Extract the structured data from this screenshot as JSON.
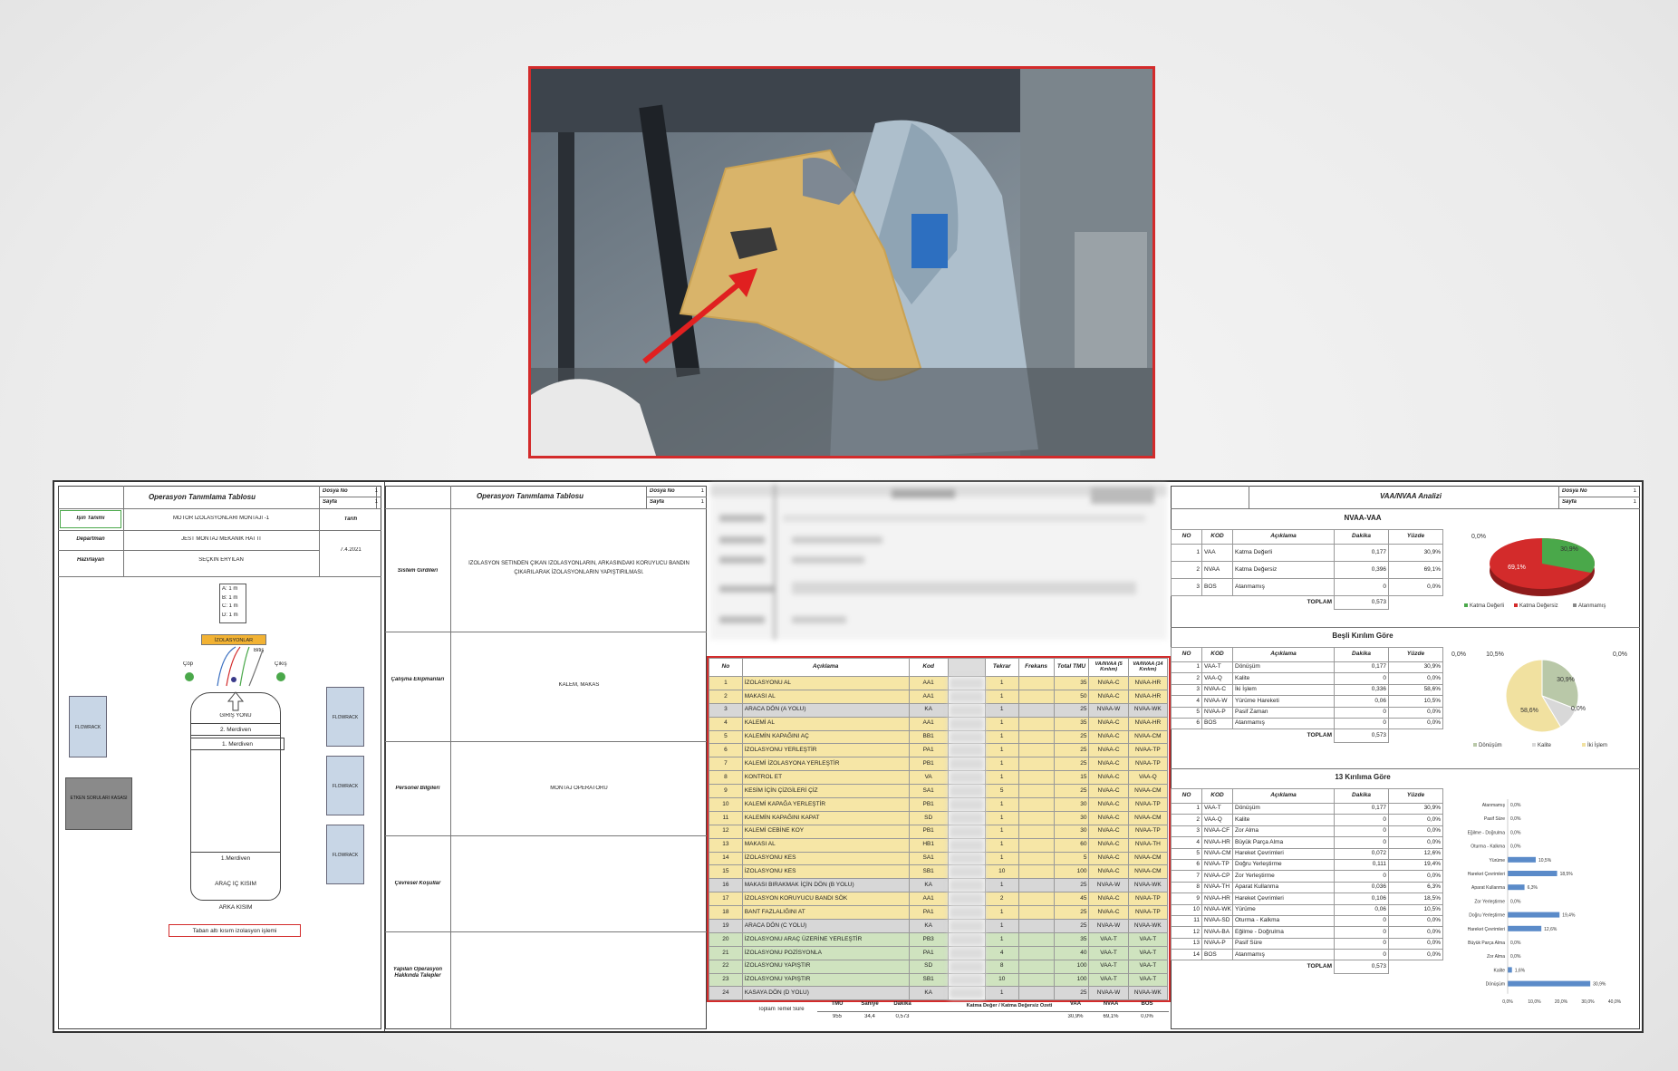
{
  "left_sheet": {
    "title": "Operasyon Tanımlama Tablosu",
    "meta": [
      "Dosya No",
      "Sayfa"
    ],
    "meta_vals": [
      "1",
      "1"
    ],
    "rows": [
      {
        "label": "İşin Tanımı",
        "value": "MOTOR İZOLASYONLARI MONTAJI -1"
      },
      {
        "label": "Departman",
        "value": "JEST MONTAJ MEKANİK HATTI"
      },
      {
        "label": "Hazırlayan",
        "value": "SEÇKİN ERYILAN"
      }
    ],
    "date_label": "Tarih",
    "date": "7.4.2021",
    "legend": [
      "A: 1 m",
      "B: 1 m",
      "C: 1 m",
      "D: 1 m"
    ],
    "box_izolasyonlar": "İZOLASYONLAR",
    "bitis": "Bitiş",
    "cop": "Çöp",
    "cikis": "Çıkış",
    "giris_yonu": "GİRİŞ YÖNÜ",
    "merdiven2": "2. Merdiven",
    "merdiven1": "1. Merdiven",
    "merdiven1b": "1.Merdiven",
    "arac_ic": "ARAÇ İÇ KISIM",
    "arka": "ARKA KISIM",
    "flowrack": "FLOWRACK",
    "etken": "ETKEN SORULARI KASASI",
    "caption": "Taban altı kısım izolasyon işlemi"
  },
  "mid_sheet": {
    "title": "Operasyon Tanımlama Tablosu",
    "meta": [
      "Dosya No",
      "Sayfa"
    ],
    "meta_vals": [
      "1",
      "1"
    ],
    "sections": [
      {
        "label": "Sistem Girdileri",
        "value": "İZOLASYON SETİNDEN ÇIKAN İZOLASYONLARIN, ARKASINDAKİ KORUYUCU BANDIN ÇIKARILARAK İZOLASYONLARIN YAPIŞTIRILMASI."
      },
      {
        "label": "Çalışma Ekipmanları",
        "value": "KALEM, MAKAS"
      },
      {
        "label": "Personel Bilgileri",
        "value": "MONTAJ OPERATÖRÜ"
      },
      {
        "label": "Çevresel Koşullar",
        "value": ""
      },
      {
        "label": "Yapılan Operasyon Hakkında Talepler",
        "value": ""
      }
    ]
  },
  "table": {
    "headers": [
      "No",
      "Açıklama",
      "Kod",
      "",
      "Tekrar",
      "Frekans",
      "Total TMU",
      "VA/NVAA (5 Kırılım)",
      "VA/NVAA (14 Kırılım)"
    ],
    "rows": [
      [
        "1",
        "İZOLASYONU AL",
        "AA1",
        "1",
        "35",
        "NVAA-C",
        "NVAA-HR",
        "y"
      ],
      [
        "2",
        "MAKASI AL",
        "AA1",
        "1",
        "50",
        "NVAA-C",
        "NVAA-HR",
        "y"
      ],
      [
        "3",
        "ARACA DÖN (A YOLU)",
        "KA",
        "1",
        "25",
        "NVAA-W",
        "NVAA-WK",
        "g"
      ],
      [
        "4",
        "KALEMİ AL",
        "AA1",
        "1",
        "35",
        "NVAA-C",
        "NVAA-HR",
        "y"
      ],
      [
        "5",
        "KALEMİN KAPAĞINI AÇ",
        "BB1",
        "1",
        "25",
        "NVAA-C",
        "NVAA-CM",
        "y"
      ],
      [
        "6",
        "İZOLASYONU YERLEŞTİR",
        "PA1",
        "1",
        "25",
        "NVAA-C",
        "NVAA-TP",
        "y"
      ],
      [
        "7",
        "KALEMİ İZOLASYONA YERLEŞTİR",
        "PB1",
        "1",
        "25",
        "NVAA-C",
        "NVAA-TP",
        "y"
      ],
      [
        "8",
        "KONTROL ET",
        "VA",
        "1",
        "15",
        "NVAA-C",
        "VAA-Q",
        "y"
      ],
      [
        "9",
        "KESİM İÇİN ÇİZGİLERİ ÇİZ",
        "SA1",
        "5",
        "25",
        "NVAA-C",
        "NVAA-CM",
        "y"
      ],
      [
        "10",
        "KALEMİ KAPAĞA YERLEŞTİR",
        "PB1",
        "1",
        "30",
        "NVAA-C",
        "NVAA-TP",
        "y"
      ],
      [
        "11",
        "KALEMİN KAPAĞINI KAPAT",
        "SD",
        "1",
        "30",
        "NVAA-C",
        "NVAA-CM",
        "y"
      ],
      [
        "12",
        "KALEMİ CEBİNE KOY",
        "PB1",
        "1",
        "30",
        "NVAA-C",
        "NVAA-TP",
        "y"
      ],
      [
        "13",
        "MAKASI AL",
        "HB1",
        "1",
        "60",
        "NVAA-C",
        "NVAA-TH",
        "y"
      ],
      [
        "14",
        "İZOLASYONU KES",
        "SA1",
        "1",
        "5",
        "NVAA-C",
        "NVAA-CM",
        "y"
      ],
      [
        "15",
        "İZOLASYONU KES",
        "SB1",
        "10",
        "100",
        "NVAA-C",
        "NVAA-CM",
        "y"
      ],
      [
        "16",
        "MAKASI BIRAKMAK İÇİN DÖN (B YOLU)",
        "KA",
        "1",
        "25",
        "NVAA-W",
        "NVAA-WK",
        "g"
      ],
      [
        "17",
        "İZOLASYON KORUYUCU BANDI SÖK",
        "AA1",
        "2",
        "45",
        "NVAA-C",
        "NVAA-TP",
        "y"
      ],
      [
        "18",
        "BANT FAZLALIĞINI AT",
        "PA1",
        "1",
        "25",
        "NVAA-C",
        "NVAA-TP",
        "y"
      ],
      [
        "19",
        "ARACA DÖN (C YOLU)",
        "KA",
        "1",
        "25",
        "NVAA-W",
        "NVAA-WK",
        "g"
      ],
      [
        "20",
        "İZOLASYONU ARAÇ ÜZERİNE YERLEŞTİR",
        "PB3",
        "1",
        "35",
        "VAA-T",
        "VAA-T",
        "gr"
      ],
      [
        "21",
        "İZOLASYONU POZİSYONLA",
        "PA1",
        "4",
        "40",
        "VAA-T",
        "VAA-T",
        "gr"
      ],
      [
        "22",
        "İZOLASYONU YAPIŞTIR",
        "SD",
        "8",
        "100",
        "VAA-T",
        "VAA-T",
        "gr"
      ],
      [
        "23",
        "İZOLASYONU YAPIŞTIR",
        "SB1",
        "10",
        "100",
        "VAA-T",
        "VAA-T",
        "gr"
      ],
      [
        "24",
        "KASAYA DÖN (D YOLU)",
        "KA",
        "1",
        "25",
        "NVAA-W",
        "NVAA-WK",
        "g"
      ]
    ],
    "footer_left": "Toplam Temel Süre",
    "footer_heads": [
      "TMU",
      "Saniye",
      "Dakika"
    ],
    "footer_vals": [
      "955",
      "34,4",
      "0,573"
    ],
    "footer_mid": "Katma Değer / Katma Değersiz Özeti",
    "footer_cats": [
      "VAA",
      "NVAA",
      "BOS"
    ],
    "footer_pcts": [
      "30,9%",
      "69,1%",
      "0,0%"
    ]
  },
  "analysis": {
    "title": "VAA/NVAA Analizi",
    "meta": [
      "Dosya No",
      "Sayfa"
    ],
    "meta_vals": [
      "1",
      "1"
    ],
    "s1_title": "NVAA-VAA",
    "s1_heads": [
      "NO",
      "KOD",
      "Açıklama",
      "Dakika",
      "Yüzde"
    ],
    "s1_rows": [
      [
        "1",
        "VAA",
        "Katma Değerli",
        "0,177",
        "30,9%"
      ],
      [
        "2",
        "NVAA",
        "Katma Değersiz",
        "0,396",
        "69,1%"
      ],
      [
        "3",
        "BOS",
        "Atanmamış",
        "0",
        "0,0%"
      ]
    ],
    "toplam": "TOPLAM",
    "total1": "0,573",
    "pie1": {
      "labels": [
        "0,0%",
        "30,9%",
        "69,1%"
      ],
      "legend": [
        "Katma Değerli",
        "Katma Değersiz",
        "Atanmamış"
      ]
    },
    "s2_title": "Beşli Kırılım Göre",
    "s2_rows": [
      [
        "1",
        "VAA-T",
        "Dönüşüm",
        "0,177",
        "30,9%"
      ],
      [
        "2",
        "VAA-Q",
        "Kalite",
        "0",
        "0,0%"
      ],
      [
        "3",
        "NVAA-C",
        "İki İşlem",
        "0,336",
        "58,6%"
      ],
      [
        "4",
        "NVAA-W",
        "Yürüme Hareketi",
        "0,06",
        "10,5%"
      ],
      [
        "5",
        "NVAA-P",
        "Pasif Zaman",
        "0",
        "0,0%"
      ],
      [
        "6",
        "BOS",
        "Atanmamış",
        "0",
        "0,0%"
      ]
    ],
    "total2": "0,573",
    "pie2": {
      "labels": [
        "0,0%",
        "10,5%",
        "0,0%",
        "30,9%",
        "58,6%",
        "0,0%"
      ],
      "legend": [
        "Dönüşüm",
        "Kalite",
        "İki İşlem"
      ]
    },
    "s3_title": "13 Kırılıma Göre",
    "s3_rows": [
      [
        "1",
        "VAA-T",
        "Dönüşüm",
        "0,177",
        "30,9%"
      ],
      [
        "2",
        "VAA-Q",
        "Kalite",
        "0",
        "0,0%"
      ],
      [
        "3",
        "NVAA-CF",
        "Zor Alma",
        "0",
        "0,0%"
      ],
      [
        "4",
        "NVAA-HR",
        "Büyük Parça Alma",
        "0",
        "0,0%"
      ],
      [
        "5",
        "NVAA-CM",
        "Hareket Çevrimleri",
        "0,072",
        "12,6%"
      ],
      [
        "6",
        "NVAA-TP",
        "Doğru Yerleştirme",
        "0,111",
        "19,4%"
      ],
      [
        "7",
        "NVAA-CP",
        "Zor Yerleştirme",
        "0",
        "0,0%"
      ],
      [
        "8",
        "NVAA-TH",
        "Aparat Kullanma",
        "0,036",
        "6,3%"
      ],
      [
        "9",
        "NVAA-HR",
        "Hareket Çevrimleri",
        "0,106",
        "18,5%"
      ],
      [
        "10",
        "NVAA-WK",
        "Yürüme",
        "0,06",
        "10,5%"
      ],
      [
        "11",
        "NVAA-SD",
        "Oturma - Kalkma",
        "0",
        "0,0%"
      ],
      [
        "12",
        "NVAA-BA",
        "Eğilme - Doğrulma",
        "0",
        "0,0%"
      ],
      [
        "13",
        "NVAA-P",
        "Pasif Süre",
        "0",
        "0,0%"
      ],
      [
        "14",
        "BOS",
        "Atanmamış",
        "0",
        "0,0%"
      ]
    ],
    "total3": "0,573",
    "bars": [
      {
        "label": "Atanmamış",
        "v": 0,
        "t": "0,0%"
      },
      {
        "label": "Pasif Süre",
        "v": 0,
        "t": "0,0%"
      },
      {
        "label": "Eğilme - Doğrulma",
        "v": 0,
        "t": "0,0%"
      },
      {
        "label": "Oturma - Kalkma",
        "v": 0,
        "t": "0,0%"
      },
      {
        "label": "Yürüme",
        "v": 10.5,
        "t": "10,5%"
      },
      {
        "label": "Hareket Çevrimleri",
        "v": 18.5,
        "t": "18,5%"
      },
      {
        "label": "Aparat Kullanma",
        "v": 6.3,
        "t": "6,3%"
      },
      {
        "label": "Zor Yerleştirme",
        "v": 0,
        "t": "0,0%"
      },
      {
        "label": "Doğru Yerleştirme",
        "v": 19.4,
        "t": "19,4%"
      },
      {
        "label": "Hareket Çevrimleri",
        "v": 12.6,
        "t": "12,6%"
      },
      {
        "label": "Büyük Parça Alma",
        "v": 0,
        "t": "0,0%"
      },
      {
        "label": "Zor Alma",
        "v": 0,
        "t": "0,0%"
      },
      {
        "label": "Kalite",
        "v": 1.6,
        "t": "1,6%"
      },
      {
        "label": "Dönüşüm",
        "v": 30.9,
        "t": "30,9%"
      }
    ],
    "axis": [
      "0,0%",
      "10,0%",
      "20,0%",
      "30,0%",
      "40,0%"
    ]
  },
  "colors": {
    "red": "#d32b2b",
    "green": "#4aa84a",
    "yellow": "#f6e6a6",
    "gray": "#d7d7d7",
    "lightgreen": "#cfe3bf",
    "bar": "#5b8bc9"
  }
}
